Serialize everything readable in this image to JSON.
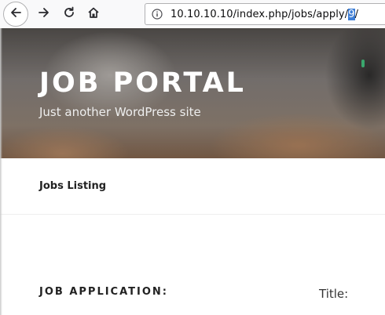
{
  "browser": {
    "url_prefix": "10.10.10.10/index.php/jobs/apply/",
    "url_selected": "9",
    "url_suffix": "/",
    "icons": {
      "back": "arrow-left-icon",
      "forward": "arrow-right-icon",
      "reload": "reload-icon",
      "home": "home-icon",
      "site_info": "info-icon"
    }
  },
  "site": {
    "title": "JOB PORTAL",
    "description": "Just another WordPress site"
  },
  "nav": {
    "items": [
      {
        "label": "Jobs Listing"
      }
    ]
  },
  "main": {
    "section_heading": "JOB APPLICATION:",
    "title_label": "Title:"
  },
  "colors": {
    "url_selection": "#3d7ed6",
    "toolbar_bg": "#f9f9fa",
    "text_dark": "#222222"
  }
}
